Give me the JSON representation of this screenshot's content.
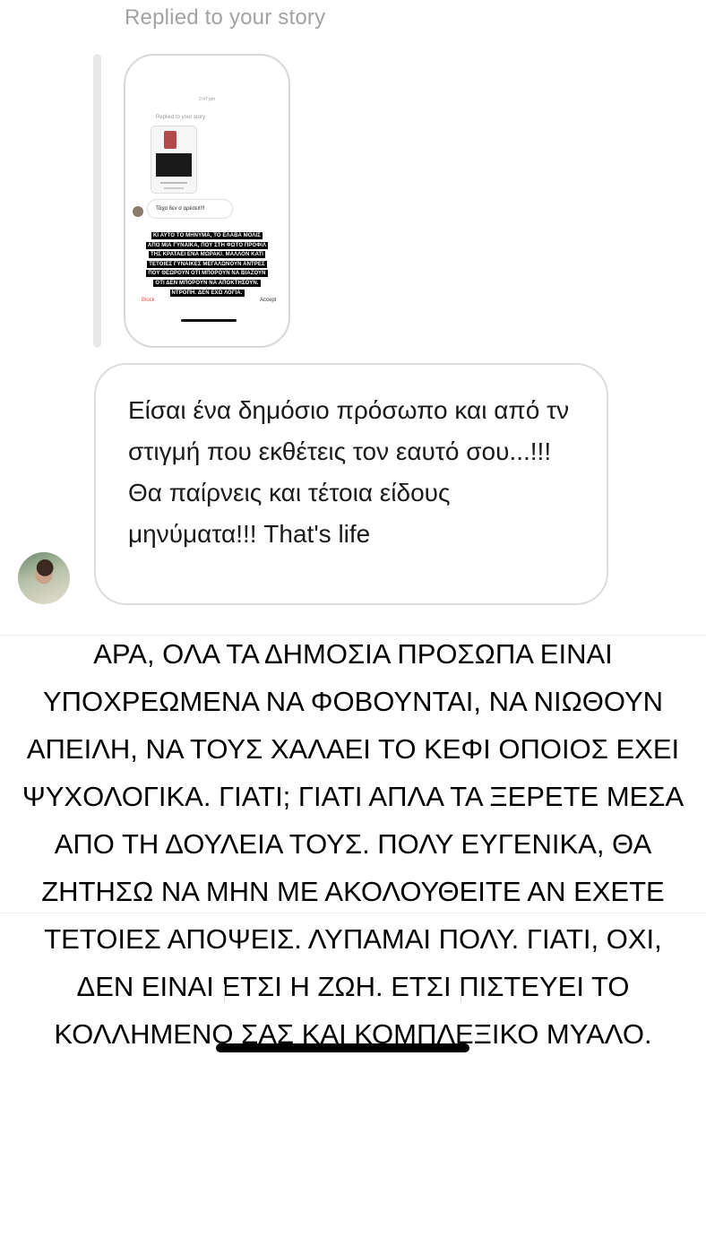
{
  "header": {
    "replied_label": "Replied to your story"
  },
  "story_preview": {
    "time": "2:47 pm",
    "replied_label": "Replied to your story",
    "reply_text": "Τάχα δεν σ αρέσει!!!!",
    "overlay_lines": [
      "ΚΙ ΑΥΤΟ ΤΟ ΜΗΝΥΜΑ, ΤΟ ΕΛΑΒΑ ΜΟΛΙΣ",
      "ΑΠΟ ΜΙΑ ΓΥΝΑΙΚΑ, ΠΟΥ ΣΤΗ ΦΩΤΟ ΠΡΟΦΙΛ",
      "ΤΗΣ ΚΡΑΤΑΕΙ ΕΝΑ ΜΩΡΑΚΙ. ΜΑΛΛΟΝ ΚΑΤΙ",
      "ΤΕΤΟΙΕΣ ΓΥΝΑΙΚΕΣ ΜΕΓΑΛΩΝΟΥΝ ΑΝΤΡΕΣ",
      "ΠΟΥ ΘΕΩΡΟΥΝ ΟΤΙ ΜΠΟΡΟΥΝ ΝΑ ΒΙΑΖΟΥΝ",
      "ΟΤΙ ΔΕΝ ΜΠΟΡΟΥΝ ΝΑ ΑΠΟΚΤΗΣΟΥΝ.",
      "ΝΤΡΟΠΗ. ΔΕΝ ΕΧΩ ΛΟΓΙΑ."
    ],
    "block_label": "Block",
    "accept_label": "Accept"
  },
  "message": {
    "text": "Είσαι ένα δημόσιο πρόσωπο και από τν στιγμή που εκθέτεις τον εαυτό σου...!!! Θα παίρνεις και τέτοια είδους μηνύματα!!! That's life"
  },
  "overlay_text": {
    "lines": [
      "ΑΡΑ, ΟΛΑ ΤΑ ΔΗΜΟΣΙΑ ΠΡΟΣΩΠΑ ΕΙΝΑΙ",
      "ΥΠΟΧΡΕΩΜΕΝΑ ΝΑ ΦΟΒΟΥΝΤΑΙ, ΝΑ ΝΙΩΘΟΥΝ",
      "ΑΠΕΙΛΗ, ΝΑ ΤΟΥΣ ΧΑΛΑΕΙ ΤΟ ΚΕΦΙ ΟΠΟΙΟΣ ΕΧΕΙ",
      "ΨΥΧΟΛΟΓΙΚΑ. ΓΙΑΤΙ; ΓΙΑΤΙ ΑΠΛΑ ΤΑ ΞΕΡΕΤΕ ΜΕΣΑ",
      "ΑΠΟ ΤΗ ΔΟΥΛΕΙΑ ΤΟΥΣ. ΠΟΛΥ ΕΥΓΕΝΙΚΑ, ΘΑ",
      "ΖΗΤΗΣΩ ΝΑ ΜΗΝ ΜΕ ΑΚΟΛΟΥΘΕΙΤΕ ΑΝ ΕΧΕΤΕ",
      "ΤΕΤΟΙΕΣ ΑΠΟΨΕΙΣ. ΛΥΠΑΜΑΙ ΠΟΛΥ. ΓΙΑΤΙ, ΟΧΙ,",
      "ΔΕΝ ΕΙΝΑΙ ΕΤΣΙ Η ΖΩΗ. ΕΤΣΙ ΠΙΣΤΕΥΕΙ ΤΟ",
      "ΚΟΛΛΗΜΕΝΟ ΣΑΣ ΚΑΙ ΚΟΜΠΛΕΞΙΚΟ ΜΥΑΛΟ."
    ]
  },
  "colors": {
    "label_gray": "#a3a3a3",
    "bubble_border": "#dcdcdc",
    "block_red": "#e05050"
  }
}
